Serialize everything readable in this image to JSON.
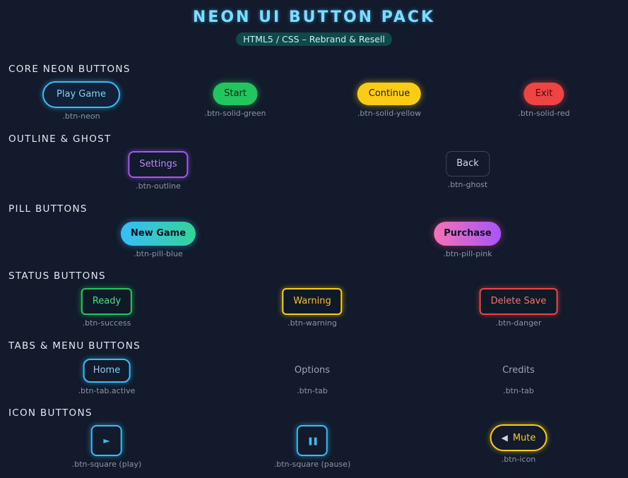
{
  "header": {
    "title": "NEON UI BUTTON PACK",
    "subtitle": "HTML5 / CSS – Rebrand & Resell"
  },
  "sections": {
    "core": {
      "title": "CORE NEON BUTTONS",
      "buttons": [
        {
          "label": "Play Game",
          "caption": ".btn-neon"
        },
        {
          "label": "Start",
          "caption": ".btn-solid-green"
        },
        {
          "label": "Continue",
          "caption": ".btn-solid-yellow"
        },
        {
          "label": "Exit",
          "caption": ".btn-solid-red"
        }
      ]
    },
    "outline": {
      "title": "OUTLINE & GHOST",
      "buttons": [
        {
          "label": "Settings",
          "caption": ".btn-outline"
        },
        {
          "label": "Back",
          "caption": ".btn-ghost"
        }
      ]
    },
    "pill": {
      "title": "PILL BUTTONS",
      "buttons": [
        {
          "label": "New Game",
          "caption": ".btn-pill-blue"
        },
        {
          "label": "Purchase",
          "caption": ".btn-pill-pink"
        }
      ]
    },
    "status": {
      "title": "STATUS BUTTONS",
      "buttons": [
        {
          "label": "Ready",
          "caption": ".btn-success"
        },
        {
          "label": "Warning",
          "caption": ".btn-warning"
        },
        {
          "label": "Delete Save",
          "caption": ".btn-danger"
        }
      ]
    },
    "tabs": {
      "title": "TABS & MENU BUTTONS",
      "buttons": [
        {
          "label": "Home",
          "caption": ".btn-tab.active"
        },
        {
          "label": "Options",
          "caption": ".btn-tab"
        },
        {
          "label": "Credits",
          "caption": ".btn-tab"
        }
      ]
    },
    "icons": {
      "title": "ICON BUTTONS",
      "buttons": [
        {
          "icon": "play-icon",
          "glyph": "►",
          "caption": ".btn-square (play)"
        },
        {
          "icon": "pause-icon",
          "glyph": "❚❚",
          "caption": ".btn-square (pause)"
        },
        {
          "icon": "speaker-icon",
          "glyph": "◀",
          "label": "Mute",
          "caption": ".btn-icon"
        }
      ]
    }
  },
  "colors": {
    "background": "#121a2b",
    "neon_blue": "#38bdf8",
    "green": "#22c55e",
    "yellow": "#facc15",
    "red": "#ef4444",
    "purple": "#a855f7",
    "pink": "#f472b6"
  }
}
